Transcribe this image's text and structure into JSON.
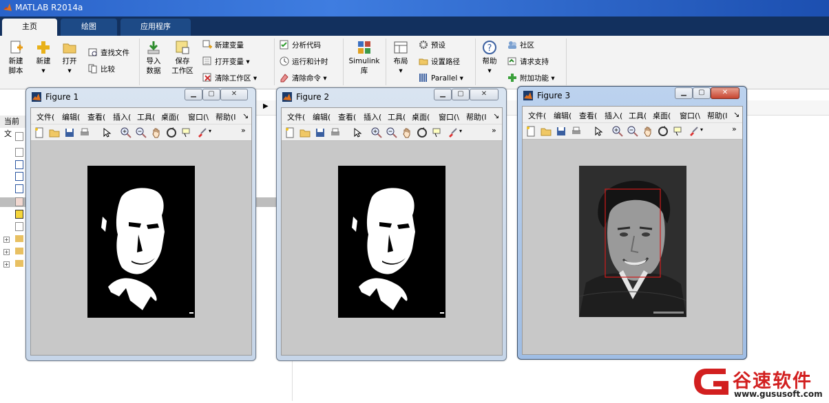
{
  "app": {
    "title": "MATLAB R2014a"
  },
  "tabs": [
    {
      "label": "主页"
    },
    {
      "label": "绘图"
    },
    {
      "label": "应用程序"
    }
  ],
  "ribbon": {
    "new_script": "新建\n脚本",
    "new_script_l1": "新建",
    "new_script_l2": "脚本",
    "new": "新建",
    "open": "打开",
    "find_files": "查找文件",
    "compare": "比较",
    "import_l1": "导入",
    "import_l2": "数据",
    "save_l1": "保存",
    "save_l2": "工作区",
    "new_variable": "新建变量",
    "open_variable": "打开变量",
    "clear_workspace": "清除工作区",
    "analyze_code": "分析代码",
    "run_time": "运行和计时",
    "clear_commands": "清除命令",
    "simulink_l1": "Simulink",
    "simulink_l2": "库",
    "layout": "布局",
    "preferences": "预设",
    "set_path": "设置路径",
    "parallel": "Parallel",
    "help": "帮助",
    "community": "社区",
    "request_support": "请求支持",
    "addons": "附加功能"
  },
  "sidebar": {
    "current_folder": "当前文"
  },
  "figures": [
    {
      "title": "Figure 1",
      "menu": [
        "文件(",
        "编辑(",
        "查看(",
        "插入(",
        "工具(",
        "桌面(",
        "窗口(\\",
        "帮助(I"
      ]
    },
    {
      "title": "Figure 2",
      "menu": [
        "文件(",
        "编辑(",
        "查看(",
        "插入(",
        "工具(",
        "桌面(",
        "窗口(\\",
        "帮助(I"
      ]
    },
    {
      "title": "Figure 3",
      "menu": [
        "文件(",
        "编辑(",
        "查看(",
        "插入(",
        "工具(",
        "桌面(",
        "窗口(\\",
        "帮助(I"
      ]
    }
  ],
  "watermark": {
    "brand": "谷速软件",
    "url": "www.gususoft.com"
  },
  "colors": {
    "matlab_blue": "#12305e",
    "face_box": "#d11a1a"
  }
}
